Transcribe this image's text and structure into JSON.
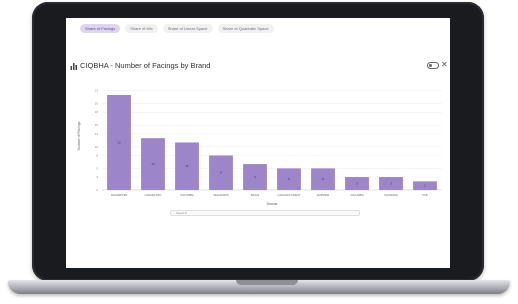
{
  "tabs": [
    {
      "label": "Share of Facings",
      "active": true
    },
    {
      "label": "Share of Mix",
      "active": false
    },
    {
      "label": "Share of Linear Space",
      "active": false
    },
    {
      "label": "Share of Quadratic Space",
      "active": false
    }
  ],
  "chart_header": {
    "title": "CIQBHA - Number of Facings by Brand",
    "chart_icon": "bar-chart-icon",
    "toggle_icon": "toggle-icon",
    "close_symbol": "✕"
  },
  "scrollbar": {
    "label": "Select ▾"
  },
  "colors": {
    "bar": "#9d85c9",
    "accent": "#5b4a8c",
    "active_tab_bg": "#ded6f1"
  },
  "chart_data": {
    "type": "bar",
    "title": "CIQBHA - Number of Facings by Brand",
    "xlabel": "Brands",
    "ylabel": "Number of Facings",
    "ylim": [
      0,
      25
    ],
    "yticks": [
      0,
      3,
      5,
      8,
      10,
      13,
      15,
      18,
      20,
      23
    ],
    "categories": [
      "SCHWEPPES",
      "CANADA DRY",
      "COLUMBIA",
      "SEAGRAM'S",
      "BIGGS",
      "CANADA'S FINEST",
      "FAIRVIEW",
      "COLUMBIA",
      "SQUAMISH",
      "PCB"
    ],
    "values": [
      22,
      12,
      11,
      8,
      6,
      5,
      5,
      3,
      3,
      2
    ]
  }
}
